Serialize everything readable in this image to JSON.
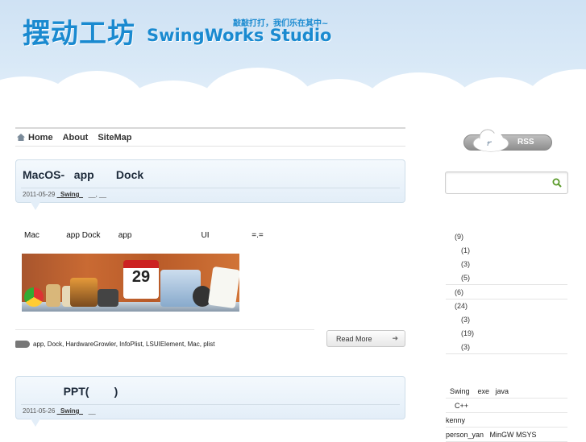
{
  "header": {
    "logo_cn": "摆动工坊",
    "logo_en": "SwingWorks Studio",
    "slogan": "敲敲打打，我们乐在其中~"
  },
  "nav": {
    "items": [
      {
        "label": "Home",
        "icon": "home-icon"
      },
      {
        "label": "About"
      },
      {
        "label": "SiteMap"
      }
    ]
  },
  "posts": [
    {
      "title": "MacOS-   app       Dock",
      "date": "2011-05-29",
      "category": "  Swing  ",
      "extra": "   __, __",
      "excerpt": "Mac            app Dock        app                               UI                   =.=",
      "tags": "app, Dock, HardwareGrowler, InfoPlist, LSUIElement, Mac, plist",
      "read_more": "Read More"
    },
    {
      "title": "             PPT(        )",
      "date": "2011-05-26",
      "category": "  Swing  ",
      "extra": "   __"
    }
  ],
  "sidebar": {
    "rss_label": "RSS",
    "search_placeholder": "",
    "categories": [
      {
        "label": "(9)",
        "level": "top"
      },
      {
        "label": "(1)",
        "level": "sub"
      },
      {
        "label": "(3)",
        "level": "sub"
      },
      {
        "label": "(5)",
        "level": "sub"
      },
      {
        "label": "(6)",
        "level": "top"
      },
      {
        "label": "(24)",
        "level": "top"
      },
      {
        "label": "(3)",
        "level": "sub"
      },
      {
        "label": "(19)",
        "level": "sub"
      },
      {
        "label": "(3)",
        "level": "sub"
      }
    ],
    "recent": [
      {
        "label": "Swing    exe   java",
        "indent": "indent"
      },
      {
        "label": "C++",
        "indent": "indent2"
      },
      {
        "label": "kenny",
        "indent": ""
      },
      {
        "label": "person_yan   MinGW MSYS",
        "indent": ""
      }
    ]
  },
  "colors": {
    "brand": "#1a8ad0",
    "sky": "#cfe2f4",
    "post_header": "#e3eef8"
  }
}
